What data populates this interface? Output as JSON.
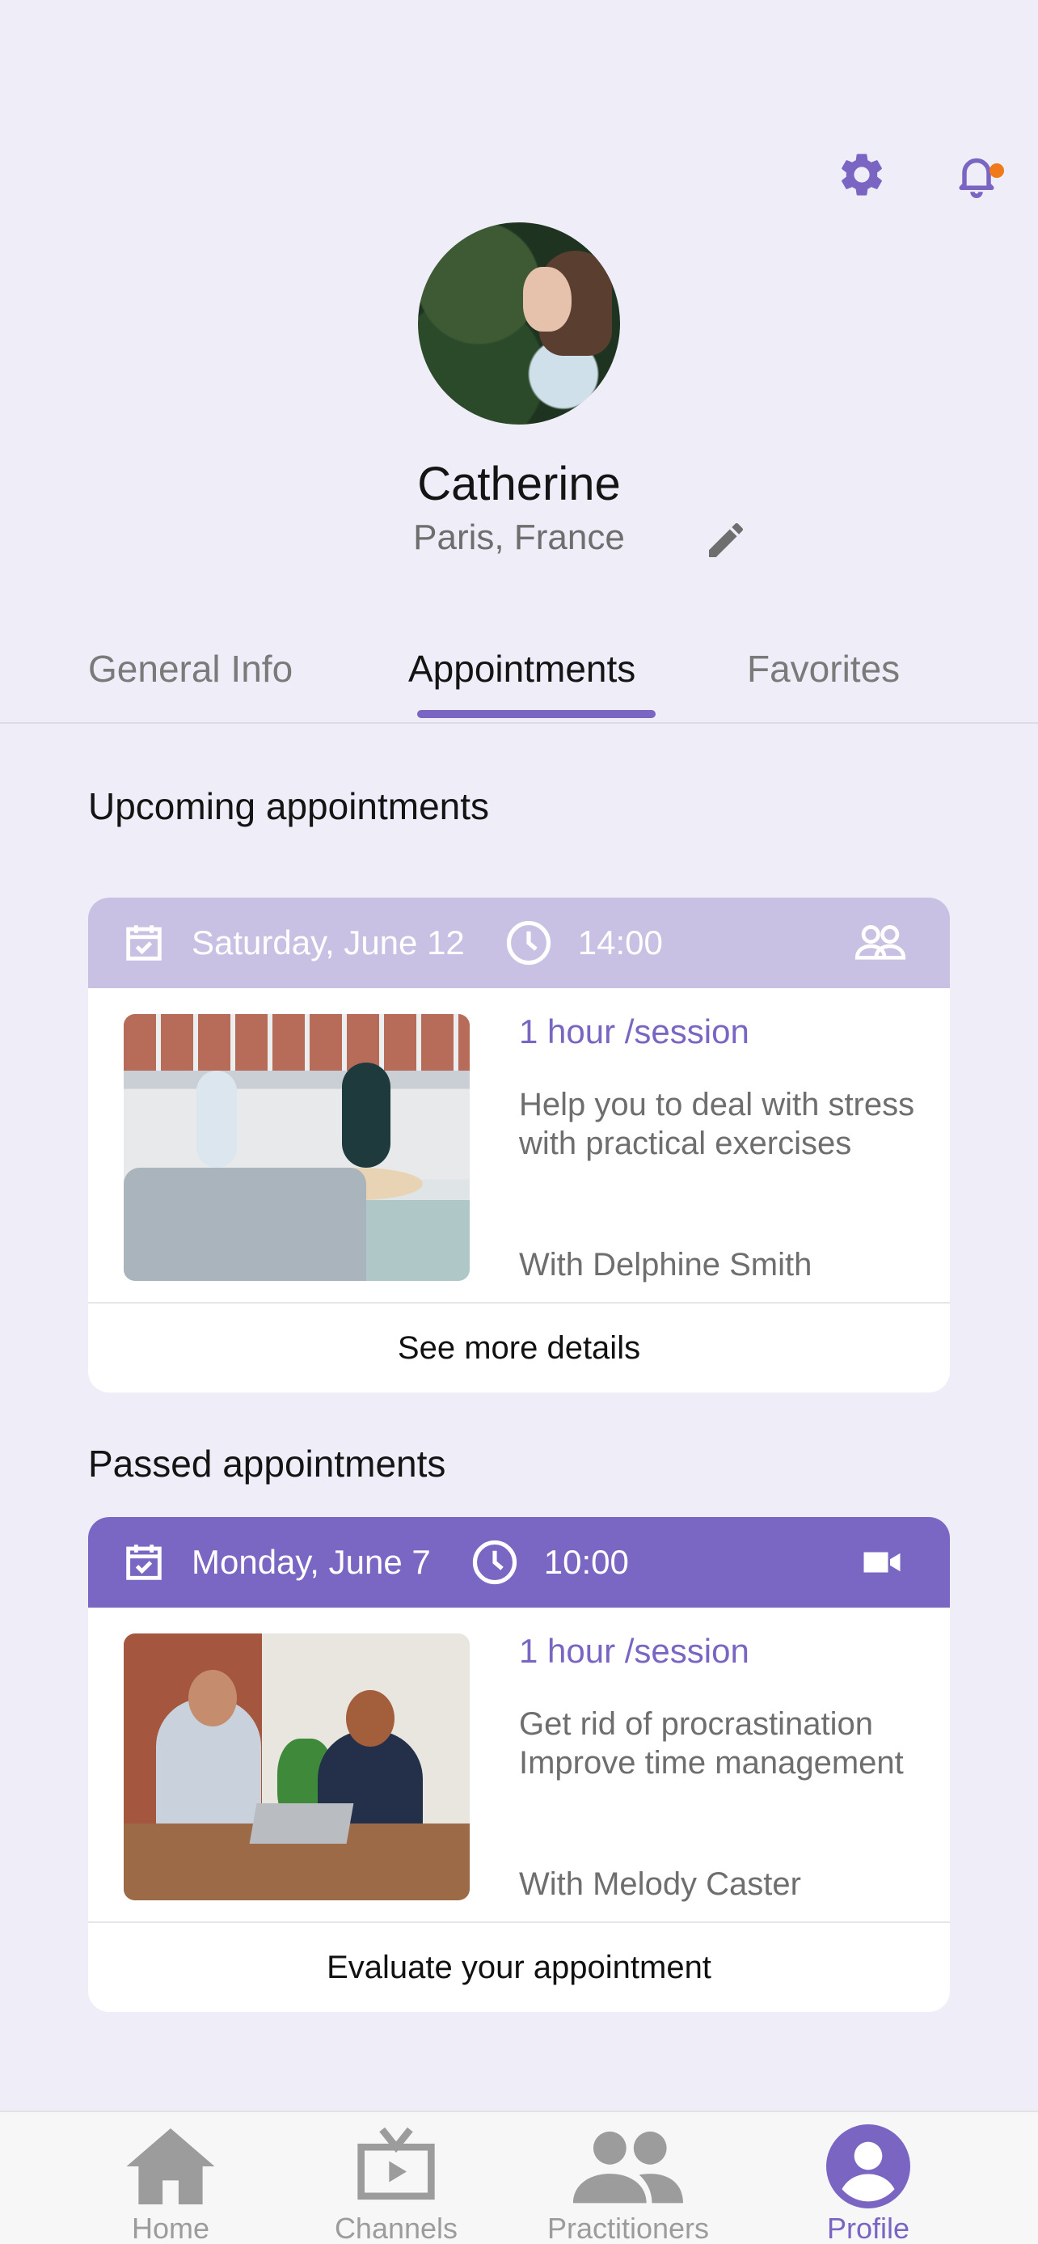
{
  "header": {
    "settings_icon": "gear-icon",
    "notifications_icon": "bell-icon",
    "has_notification": true
  },
  "profile": {
    "name": "Catherine",
    "location": "Paris, France"
  },
  "tabs": [
    {
      "label": "General Info",
      "active": false
    },
    {
      "label": "Appointments",
      "active": true
    },
    {
      "label": "Favorites",
      "active": false
    }
  ],
  "upcoming": {
    "title": "Upcoming appointments",
    "appointment": {
      "date": "Saturday, June 12",
      "time": "14:00",
      "kind_icon": "group-icon",
      "duration": "1 hour /session",
      "description": "Help you to deal with stress with practical exercises",
      "with": "With Delphine Smith",
      "action": "See more details"
    }
  },
  "passed": {
    "title": "Passed appointments",
    "appointment": {
      "date": "Monday, June 7",
      "time": "10:00",
      "kind_icon": "video-camera-icon",
      "duration": "1 hour /session",
      "description": "Get rid of procrastination Improve time management",
      "with": "With Melody Caster",
      "action": "Evaluate your appointment"
    }
  },
  "nav": [
    {
      "label": "Home",
      "icon": "home-icon",
      "active": false
    },
    {
      "label": "Channels",
      "icon": "tv-icon",
      "active": false
    },
    {
      "label": "Practitioners",
      "icon": "people-icon",
      "active": false
    },
    {
      "label": "Profile",
      "icon": "profile-icon",
      "active": true
    }
  ],
  "colors": {
    "accent": "#7a66c2",
    "background": "#efedf8",
    "upcoming_header": "#c8c1e4",
    "passed_header": "#7a67c3",
    "notification_dot": "#f07a1a"
  }
}
